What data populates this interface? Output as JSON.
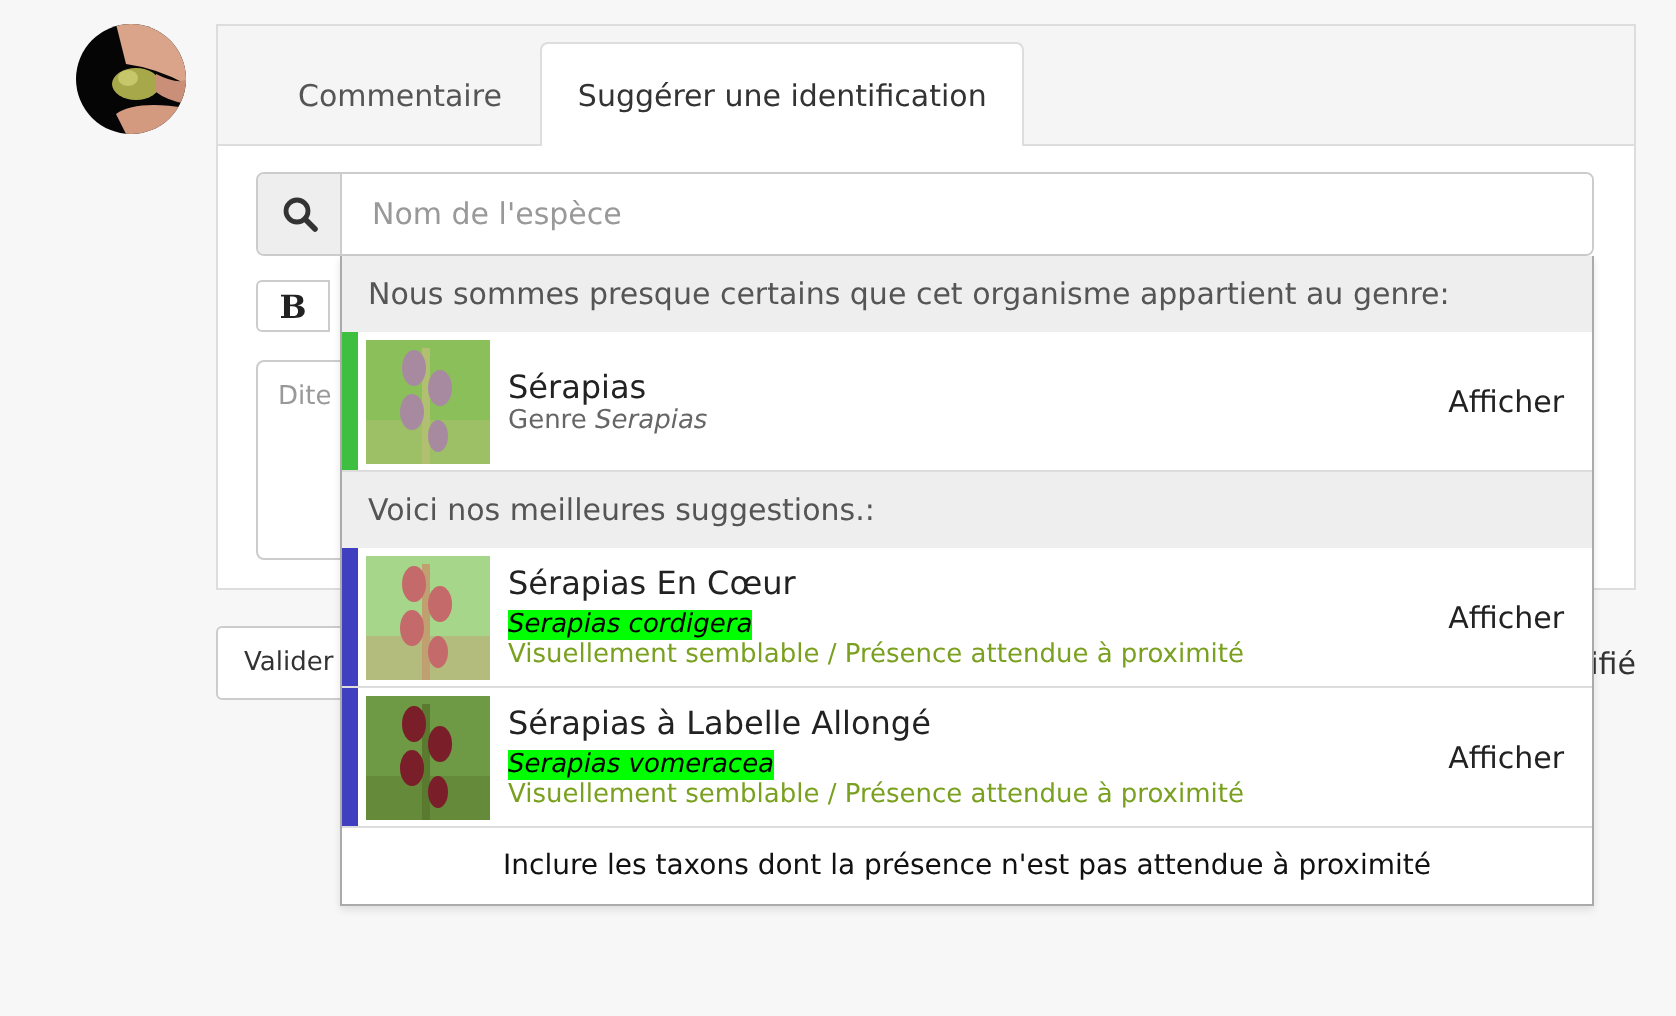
{
  "tabs": [
    {
      "label": "Commentaire",
      "selected": false
    },
    {
      "label": "Suggérer une identification",
      "selected": true
    }
  ],
  "search": {
    "placeholder": "Nom de l'espèce"
  },
  "toolbar": {
    "bold_button": "B"
  },
  "comment": {
    "placeholder": "Dite"
  },
  "submit_button": "Valider",
  "side_text": "ifié",
  "dropdown": {
    "sections": [
      {
        "heading": "Nous sommes presque certains que cet organisme appartient au genre:",
        "results": [
          {
            "kind": "genus",
            "name": "Sérapias",
            "rank_label": "Genre *Serapias*",
            "action": "Afficher",
            "color": "#3fbf3f"
          }
        ]
      },
      {
        "heading": "Voici nos meilleures suggestions.:",
        "results": [
          {
            "kind": "species",
            "name": "Sérapias En Cœur",
            "scientific_name": "Serapias cordigera",
            "highlighted": true,
            "reason": "Visuellement semblable / Présence attendue à proximité",
            "action": "Afficher",
            "color": "#3f3fbf"
          },
          {
            "kind": "species",
            "name": "Sérapias à Labelle Allongé",
            "scientific_name": "Serapias vomeracea",
            "highlighted": true,
            "reason": "Visuellement semblable / Présence attendue à proximité",
            "action": "Afficher",
            "color": "#3f3fbf"
          }
        ]
      }
    ],
    "footer": "Inclure les taxons dont la présence n'est pas attendue à proximité"
  }
}
